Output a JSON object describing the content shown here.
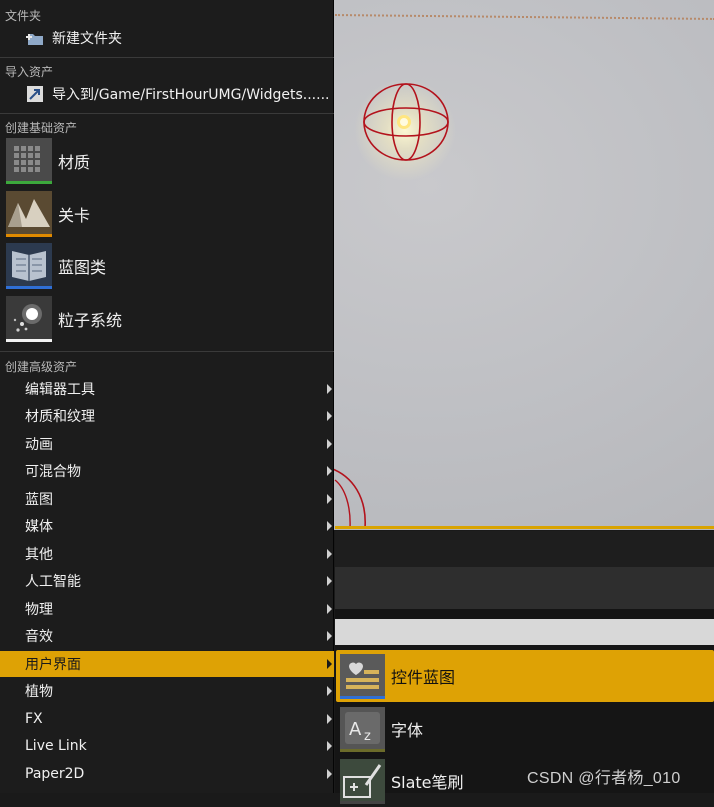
{
  "menu": {
    "folder_header": "文件夹",
    "new_folder": "新建文件夹",
    "import_header": "导入资产",
    "import_to": "导入到/Game/FirstHourUMG/Widgets......",
    "basic_header": "创建基础资产",
    "basic_assets": [
      {
        "label": "材质",
        "icon": "material-icon",
        "color": "#3ca83c"
      },
      {
        "label": "关卡",
        "icon": "level-icon",
        "color": "#e08a00"
      },
      {
        "label": "蓝图类",
        "icon": "blueprint-class-icon",
        "color": "#2f6fd6"
      },
      {
        "label": "粒子系统",
        "icon": "particle-system-icon",
        "color": "#f2f2f2"
      }
    ],
    "advanced_header": "创建高级资产",
    "advanced_items": [
      "编辑器工具",
      "材质和纹理",
      "动画",
      "可混合物",
      "蓝图",
      "媒体",
      "其他",
      "人工智能",
      "物理",
      "音效",
      "用户界面",
      "植物",
      "FX",
      "Live Link",
      "Paper2D"
    ],
    "active_item": "用户界面"
  },
  "submenu": {
    "items": [
      {
        "label": "控件蓝图",
        "icon": "widget-blueprint-icon",
        "color": "#2f6fd6"
      },
      {
        "label": "字体",
        "icon": "font-icon",
        "color": "#6b6b2a"
      },
      {
        "label": "Slate笔刷",
        "icon": "slate-brush-icon",
        "color": "#3a6a3a"
      }
    ],
    "active_item": "控件蓝图"
  },
  "watermark": "CSDN @行者杨_010",
  "colors": {
    "accent": "#dea205",
    "menu_bg": "#1c1c1c"
  }
}
